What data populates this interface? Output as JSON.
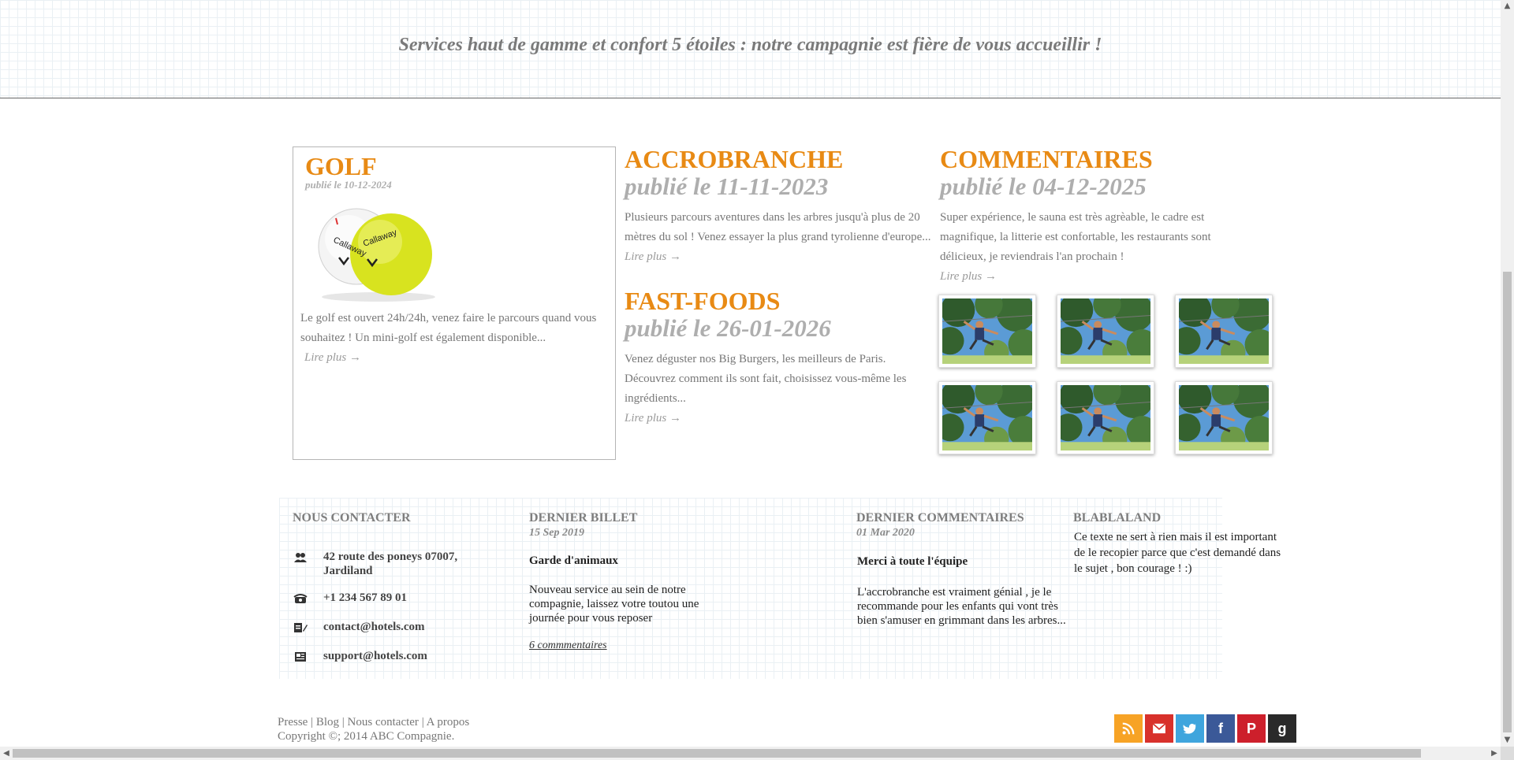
{
  "header": {
    "tagline": "Services haut de gamme et confort 5 étoiles : notre campagnie est fière de vous accueillir !"
  },
  "articles": {
    "golf": {
      "title": "GOLF",
      "date": "publié le 10-12-2024",
      "body": "Le golf est ouvert 24h/24h, venez faire le parcours quand vous souhaitez ! Un mini-golf est également disponible...",
      "more": "Lire plus →",
      "image_brand": "Callaway"
    },
    "accro": {
      "title": "ACCROBRANCHE",
      "date": "publié le 11-11-2023",
      "body": "Plusieurs parcours aventures dans les arbres jusqu'à plus de 20 mètres du sol ! Venez essayer la plus grand tyrolienne d'europe...",
      "more": "Lire plus →"
    },
    "fast": {
      "title": "FAST-FOODS",
      "date": "publié le 26-01-2026",
      "body": "Venez déguster nos Big Burgers, les meilleurs de Paris. Découvrez comment ils sont fait, choisissez vous-même les ingrédients...",
      "more": "Lire plus →"
    },
    "comments": {
      "title": "COMMENTAIRES",
      "date": "publié le 04-12-2025",
      "body": "Super expérience, le sauna est très agrèable, le cadre est magnifique, la litterie est confortable, les restaurants sont délicieux, je reviendrais l'an prochain !",
      "more": "Lire plus →"
    }
  },
  "gallery": {
    "count": 6
  },
  "footer": {
    "contact": {
      "title": "NOUS CONTACTER",
      "address": "42 route des poneys 07007, Jardiland",
      "phone": "+1 234 567 89 01",
      "email": "contact@hotels.com",
      "support": "support@hotels.com"
    },
    "last_post": {
      "title": "DERNIER BILLET",
      "date": "15 Sep 2019",
      "post_title": "Garde d'animaux",
      "body": "Nouveau service au sein de notre compagnie, laissez votre toutou une journée pour vous reposer",
      "comments_link": "6 commmentaires"
    },
    "last_comment": {
      "title": "DERNIER COMMENTAIRES",
      "date": "01 Mar 2020",
      "post_title": "Merci à toute l'équipe",
      "body": "L'accrobranche est vraiment génial , je le recommande pour les enfants qui vont très bien s'amuser en grimmant dans les arbres..."
    },
    "blabla": {
      "title": "BLABLALAND",
      "body": "Ce texte ne sert à rien mais il est important de le recopier parce que c'est demandé dans le sujet , bon courage ! :)"
    },
    "links": [
      "Presse",
      "Blog",
      "Nous contacter",
      "A propos"
    ],
    "copyright": "Copyright ©; 2014 ABC Compagnie."
  },
  "social": {
    "icons": [
      "rss-icon",
      "mail-icon",
      "twitter-icon",
      "facebook-icon",
      "pinterest-icon",
      "google-plus-icon"
    ],
    "colors": [
      "#f7a325",
      "#d8312b",
      "#3fa5dd",
      "#3b5998",
      "#cd1f2b",
      "#2a2a2a"
    ],
    "labels": [
      "",
      "",
      "",
      "f",
      "P",
      "g"
    ]
  },
  "colors": {
    "accent": "#e88a14",
    "muted": "#aeaeae"
  }
}
